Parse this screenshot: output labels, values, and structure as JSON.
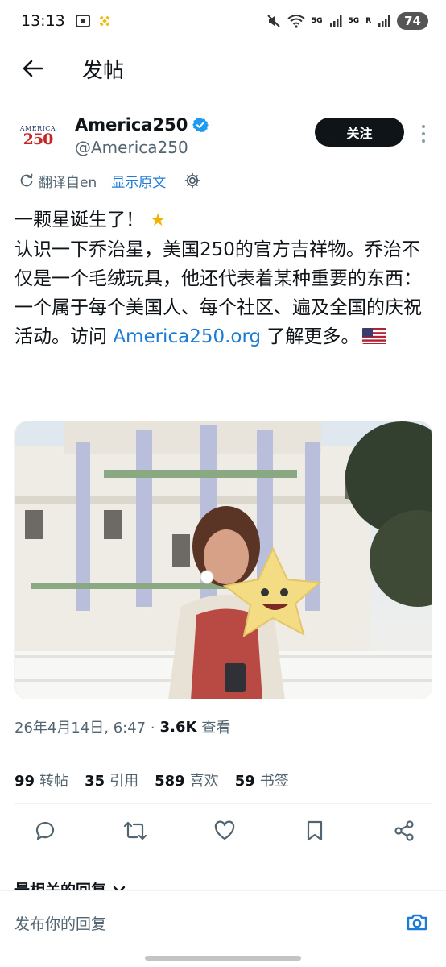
{
  "status_bar": {
    "time": "13:13",
    "network_1": "5G",
    "network_2": "5G",
    "roaming": "R",
    "battery": "74"
  },
  "header": {
    "title": "发帖"
  },
  "author": {
    "avatar_top": "AMERICA",
    "avatar_num": "250",
    "display_name": "America250",
    "handle": "@America250",
    "follow_label": "关注"
  },
  "translate": {
    "label": "翻译自en",
    "show_original": "显示原文"
  },
  "post": {
    "line1": "一颗星诞生了！",
    "body_before_link": "认识一下乔治星，美国250的官方吉祥物。乔治不仅是一个毛绒玩具，他还代表着某种重要的东西：一个属于每个美国人、每个社区、遍及全国的庆祝活动。访问 ",
    "link": "America250.org",
    "body_after_link": " 了解更多。"
  },
  "meta": {
    "datetime": "26年4月14日, 6:47 · ",
    "views_count": "3.6K",
    "views_label": "查看"
  },
  "stats": {
    "reposts_num": "99",
    "reposts_label": "转帖",
    "quotes_num": "35",
    "quotes_label": "引用",
    "likes_num": "589",
    "likes_label": "喜欢",
    "bookmarks_num": "59",
    "bookmarks_label": "书签"
  },
  "replies": {
    "header": "最相关的回复"
  },
  "reply_bar": {
    "placeholder": "发布你的回复"
  },
  "colors": {
    "accent": "#1d7bd8",
    "text_primary": "#0f1419",
    "text_secondary": "#536471",
    "verified": "#1d9bf0"
  }
}
